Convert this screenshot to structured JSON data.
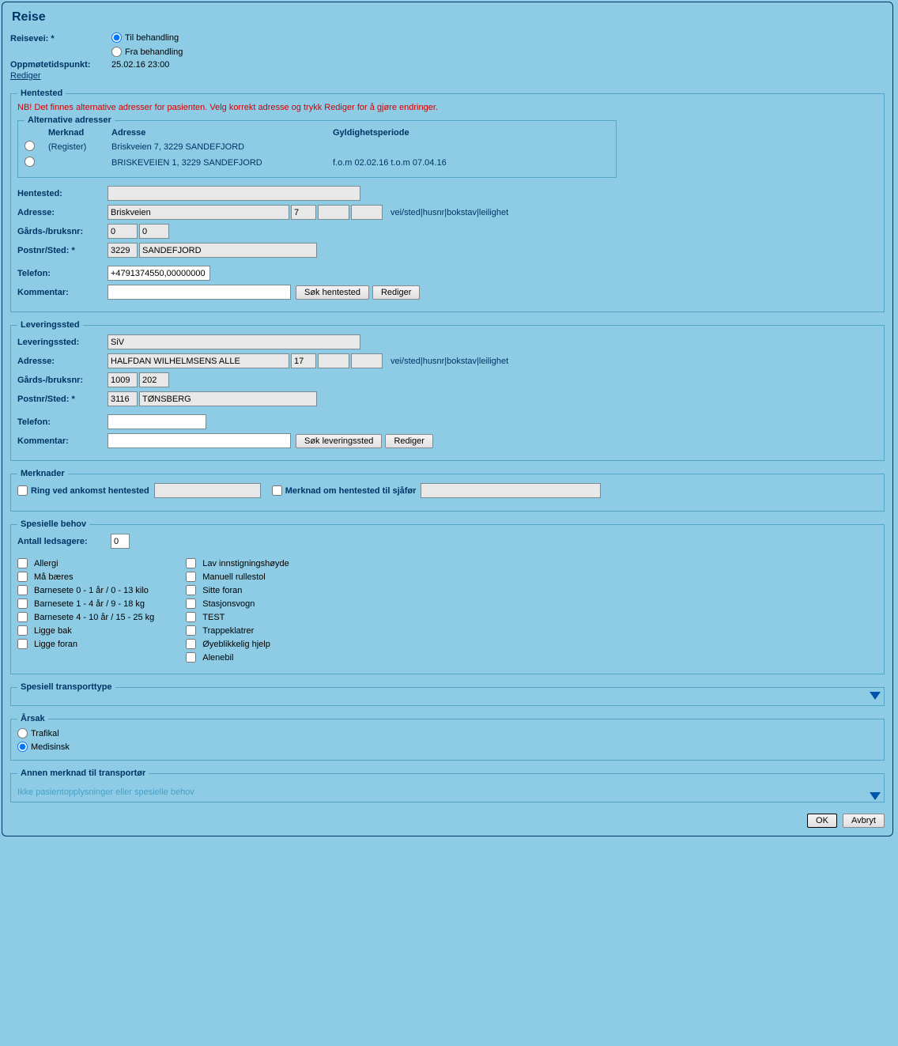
{
  "title": "Reise",
  "reisevei": {
    "label": "Reisevei: *",
    "option_to": "Til behandling",
    "option_from": "Fra behandling",
    "selected": "to"
  },
  "oppmote": {
    "label": "Oppmøtetidspunkt:",
    "value": "25.02.16 23:00"
  },
  "rediger_link": "Rediger",
  "hentested": {
    "legend": "Hentested",
    "warning": "NB! Det finnes alternative adresser for pasienten. Velg korrekt adresse og trykk Rediger for å gjøre endringer.",
    "alt_legend": "Alternative adresser",
    "headers": {
      "merk": "Merknad",
      "addr": "Adresse",
      "valid": "Gyldighetsperiode"
    },
    "addresses": [
      {
        "merk": "(Register)",
        "addr": "Briskveien 7, 3229 SANDEFJORD",
        "valid": ""
      },
      {
        "merk": "",
        "addr": "BRISKEVEIEN 1, 3229 SANDEFJORD",
        "valid": "f.o.m 02.02.16  t.o.m 07.04.16"
      }
    ],
    "fields": {
      "hentested_label": "Hentested:",
      "hentested": "",
      "adresse_label": "Adresse:",
      "street": "Briskveien",
      "housenr": "7",
      "letter": "",
      "apt": "",
      "hint": "vei/sted|husnr|bokstav|leilighet",
      "gnr_label": "Gårds-/bruksnr:",
      "gnr": "0",
      "bnr": "0",
      "post_label": "Postnr/Sted: *",
      "postnr": "3229",
      "sted": "SANDEFJORD",
      "tel_label": "Telefon:",
      "tel": "+4791374550,00000000",
      "kommentar_label": "Kommentar:",
      "sok": "Søk hentested",
      "rediger": "Rediger"
    }
  },
  "leveringssted": {
    "legend": "Leveringssted",
    "fields": {
      "lever_label": "Leveringssted:",
      "lever": "SiV",
      "adresse_label": "Adresse:",
      "street": "HALFDAN WILHELMSENS ALLE",
      "housenr": "17",
      "letter": "",
      "apt": "",
      "hint": "vei/sted|husnr|bokstav|leilighet",
      "gnr_label": "Gårds-/bruksnr:",
      "gnr": "1009",
      "bnr": "202",
      "post_label": "Postnr/Sted: *",
      "postnr": "3116",
      "sted": "TØNSBERG",
      "tel_label": "Telefon:",
      "tel": "",
      "kommentar_label": "Kommentar:",
      "sok": "Søk leveringssted",
      "rediger": "Rediger"
    }
  },
  "merknader": {
    "legend": "Merknader",
    "ring_label": "Ring ved ankomst hentested",
    "merk_label": "Merknad om hentested til sjåfør"
  },
  "spesielle": {
    "legend": "Spesielle behov",
    "antall_label": "Antall ledsagere:",
    "antall": "0",
    "col1": [
      "Allergi",
      "Må bæres",
      "Barnesete 0 - 1 år / 0 - 13 kilo",
      "Barnesete 1 - 4 år / 9 - 18 kg",
      "Barnesete 4 - 10 år / 15 - 25 kg",
      "Ligge bak",
      "Ligge foran"
    ],
    "col2": [
      "Lav innstigningshøyde",
      "Manuell rullestol",
      "Sitte foran",
      "Stasjonsvogn",
      "TEST",
      "Trappeklatrer",
      "Øyeblikkelig hjelp",
      "Alenebil"
    ]
  },
  "transporttype": {
    "legend": "Spesiell transporttype"
  },
  "arsak": {
    "legend": "Årsak",
    "trafikal": "Trafikal",
    "medisinsk": "Medisinsk",
    "selected": "medisinsk"
  },
  "annen": {
    "legend": "Annen merknad til transportør",
    "note": "Ikke pasientopplysninger eller spesielle behov"
  },
  "buttons": {
    "ok": "OK",
    "avbryt": "Avbryt"
  }
}
